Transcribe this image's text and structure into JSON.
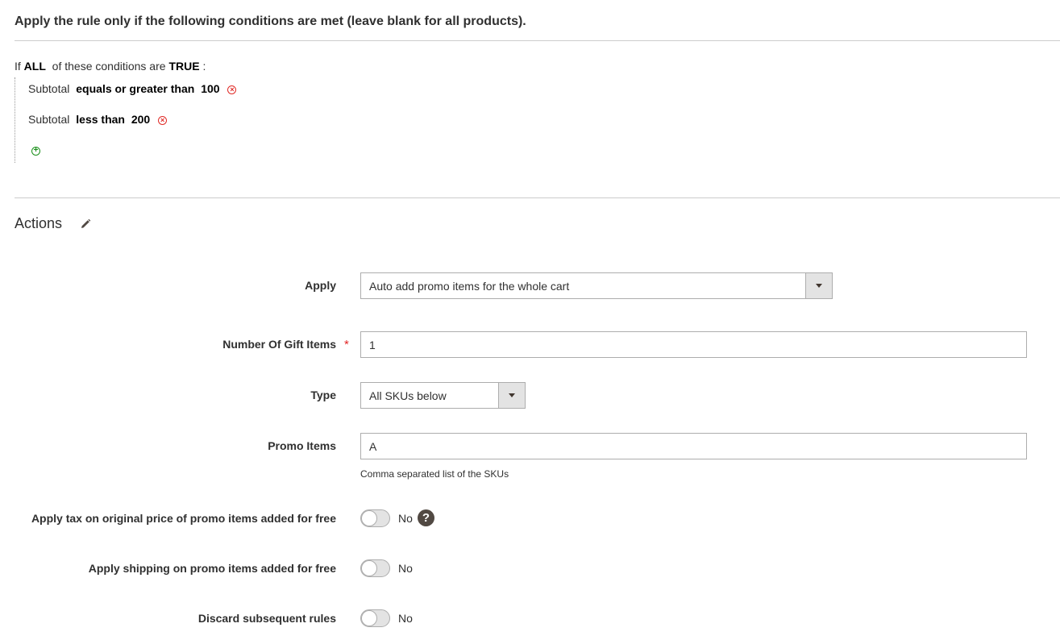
{
  "conditions": {
    "title": "Apply the rule only if the following conditions are met (leave blank for all products).",
    "summary": {
      "prefix": "If",
      "aggregator": "ALL",
      "middle": "of these conditions are",
      "value": "TRUE",
      "suffix": ":"
    },
    "rows": [
      {
        "attribute": "Subtotal",
        "operator": "equals or greater than",
        "value": "100"
      },
      {
        "attribute": "Subtotal",
        "operator": "less than",
        "value": "200"
      }
    ],
    "remove_icon": "remove-circle-icon",
    "add_icon": "add-circle-icon"
  },
  "actions": {
    "title": "Actions",
    "edit_icon": "pencil-icon",
    "apply": {
      "label": "Apply",
      "value": "Auto add promo items for the whole cart"
    },
    "gift_items": {
      "label": "Number Of Gift Items",
      "required_mark": "*",
      "value": "1"
    },
    "type": {
      "label": "Type",
      "value": "All SKUs below"
    },
    "promo_items": {
      "label": "Promo Items",
      "value": "A",
      "note": "Comma separated list of the SKUs"
    },
    "apply_tax": {
      "label": "Apply tax on original price of promo items added for free",
      "state": "No",
      "help": "?"
    },
    "apply_shipping": {
      "label": "Apply shipping on promo items added for free",
      "state": "No"
    },
    "discard_rules": {
      "label": "Discard subsequent rules",
      "state": "No"
    }
  },
  "colors": {
    "required": "#e22626",
    "remove": "#e02b27",
    "add": "#1a8f1a",
    "help_bg": "#514943"
  }
}
